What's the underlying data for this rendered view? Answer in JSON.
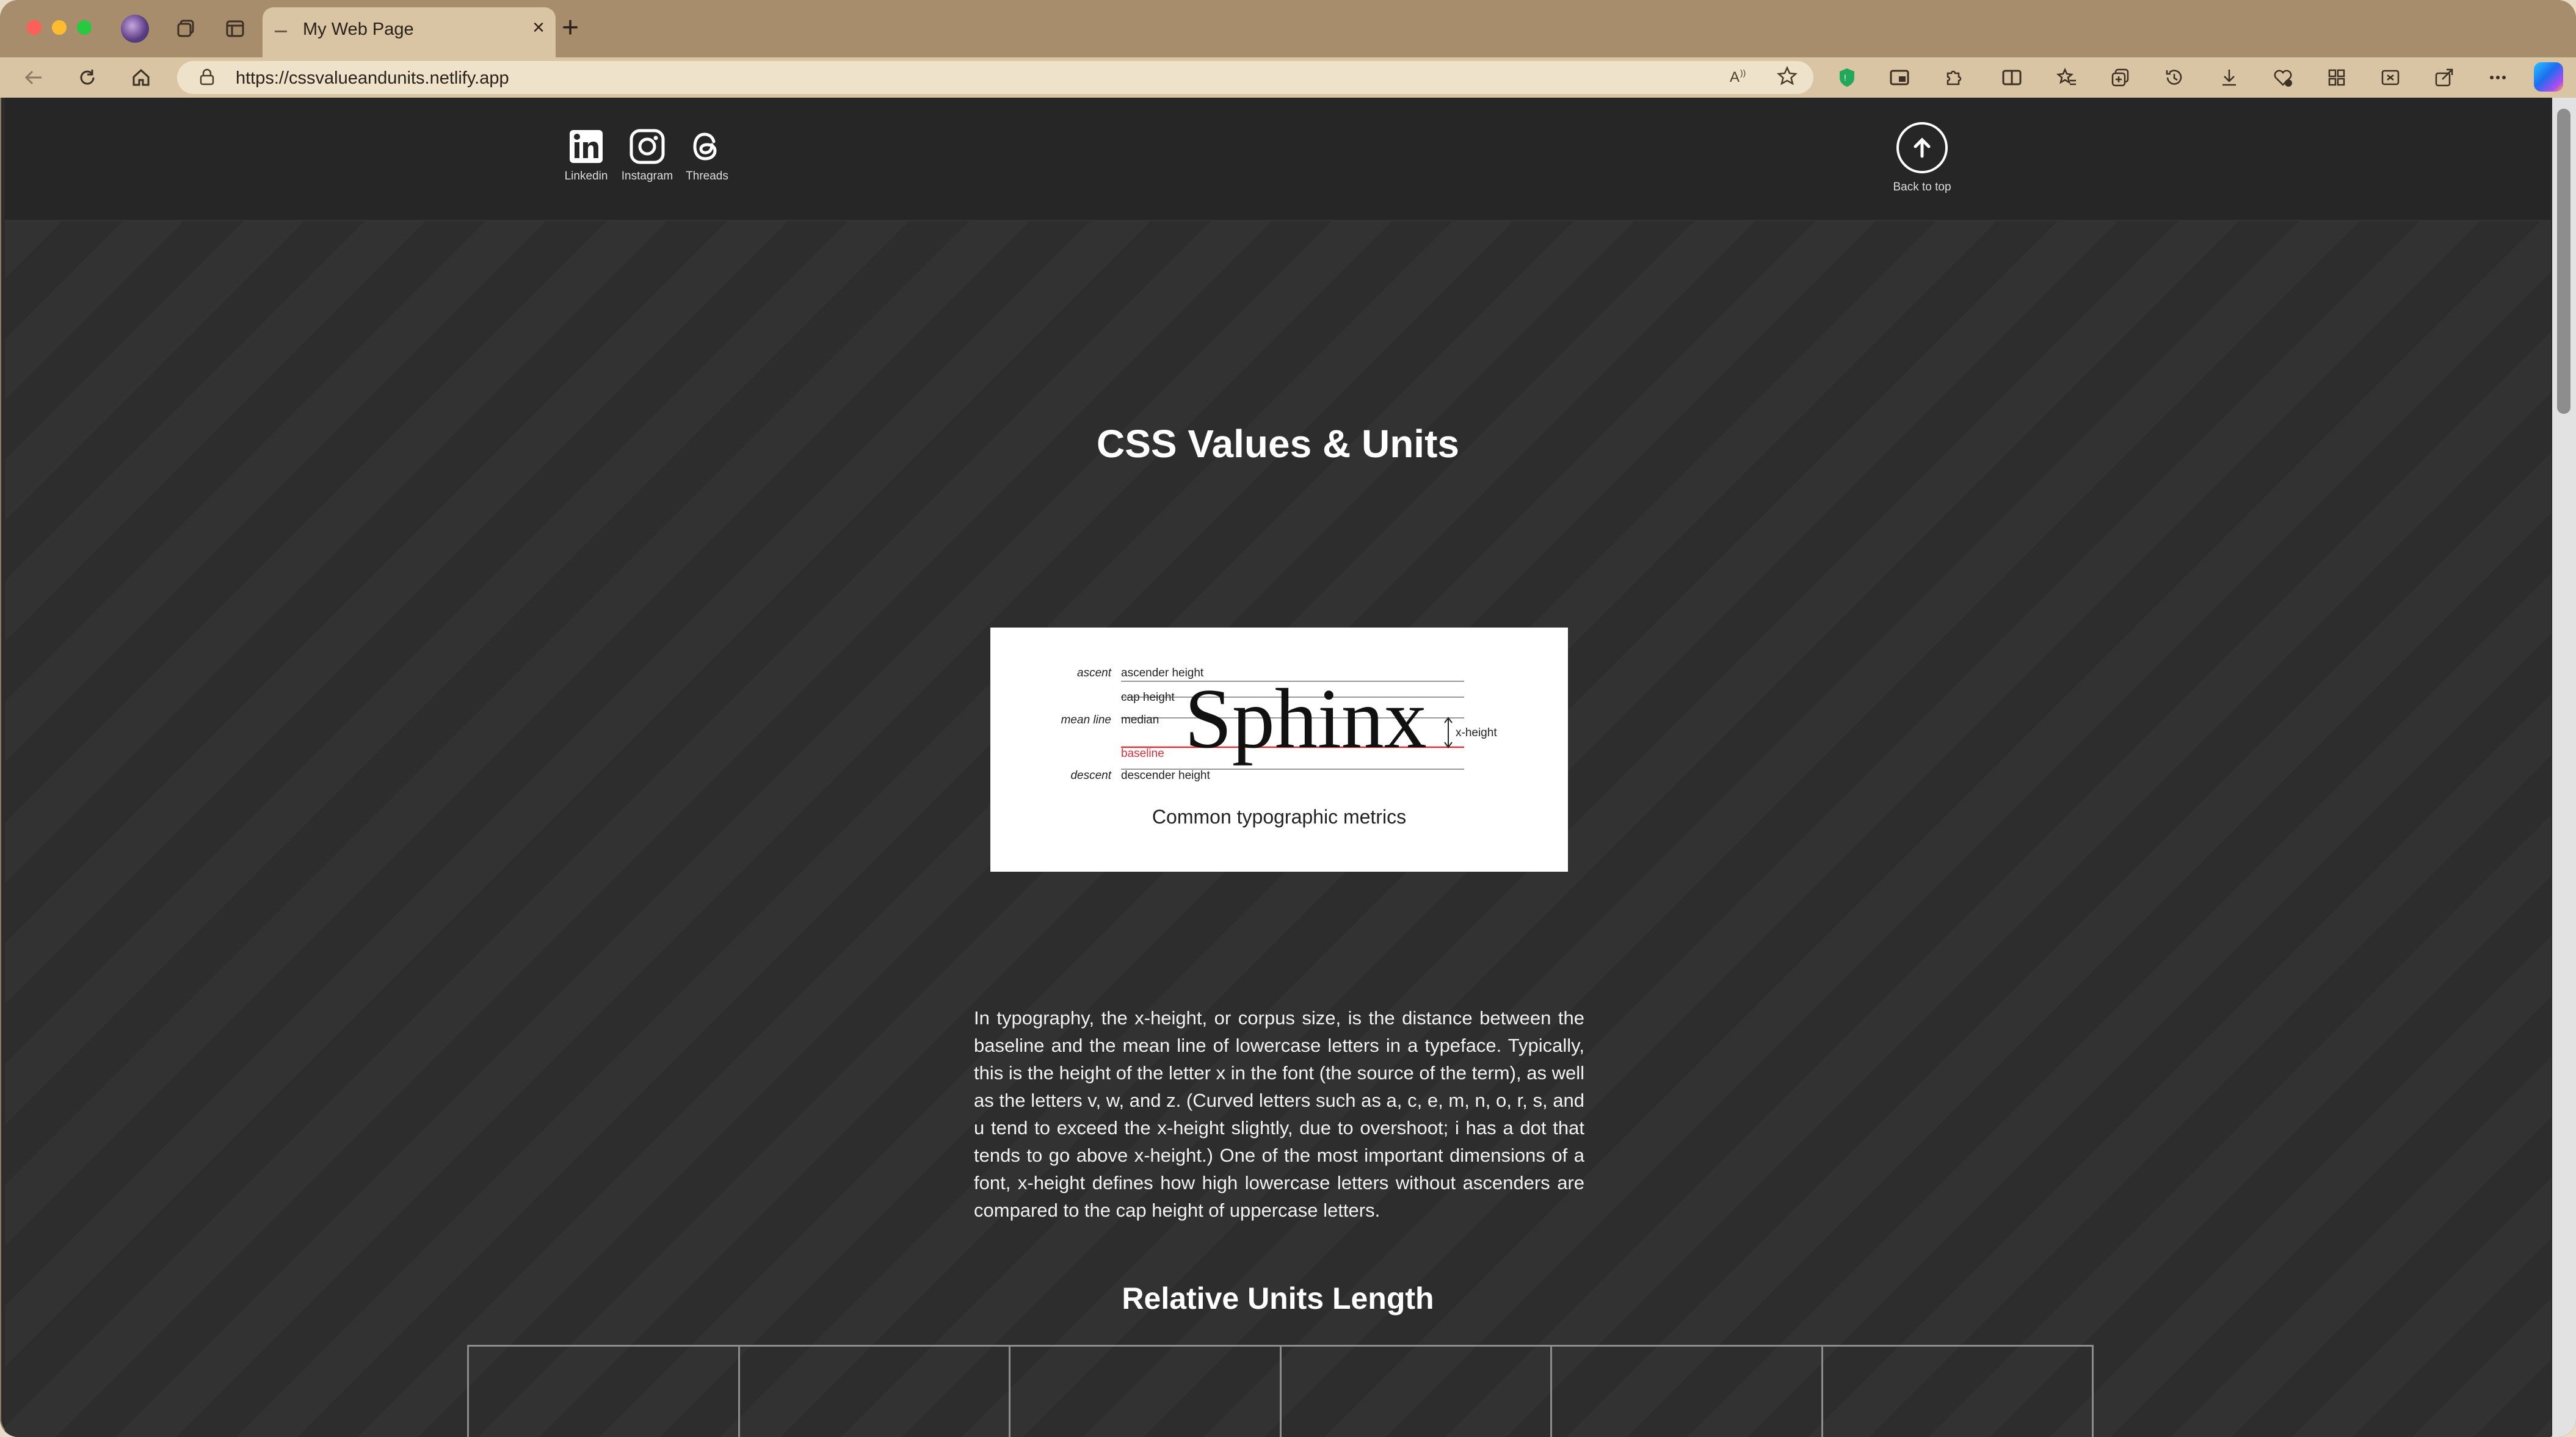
{
  "browser": {
    "tab_title": "My Web Page",
    "url": "https://cssvalueandunits.netlify.app",
    "tab_close_icon": "×",
    "new_tab_icon": "+"
  },
  "header": {
    "social": [
      {
        "label": "Linkedin",
        "icon": "linkedin-icon"
      },
      {
        "label": "Instagram",
        "icon": "instagram-icon"
      },
      {
        "label": "Threads",
        "icon": "threads-icon"
      }
    ],
    "back_to_top": "Back to top"
  },
  "main": {
    "title": "CSS Values & Units",
    "figure": {
      "left_labels": {
        "ascent": "ascent",
        "mean_line": "mean line",
        "descent": "descent"
      },
      "line_labels": {
        "ascender": "ascender height",
        "cap": "cap height",
        "median": "median",
        "baseline": "baseline",
        "descender": "descender height"
      },
      "word": "Sphinx",
      "x_height": "x-height",
      "caption": "Common typographic metrics"
    },
    "paragraph": "In typography, the x-height, or corpus size, is the distance between the baseline and the mean line of lowercase letters in a typeface. Typically, this is the height of the letter x in the font (the source of the term), as well as the letters v, w, and z. (Curved letters such as a, c, e, m, n, o, r, s, and u tend to exceed the x-height slightly, due to overshoot; i has a dot that tends to go above x-height.) One of the most important dimensions of a font, x-height defines how high lowercase letters without ascenders are compared to the cap height of uppercase letters.",
    "subtitle": "Relative Units Length",
    "table_columns": 6
  },
  "colors": {
    "tab_bar": "#a88d6c",
    "toolbar": "#d9c4a3",
    "page_bg": "#2d2d2d",
    "baseline_red": "#d6313d"
  }
}
